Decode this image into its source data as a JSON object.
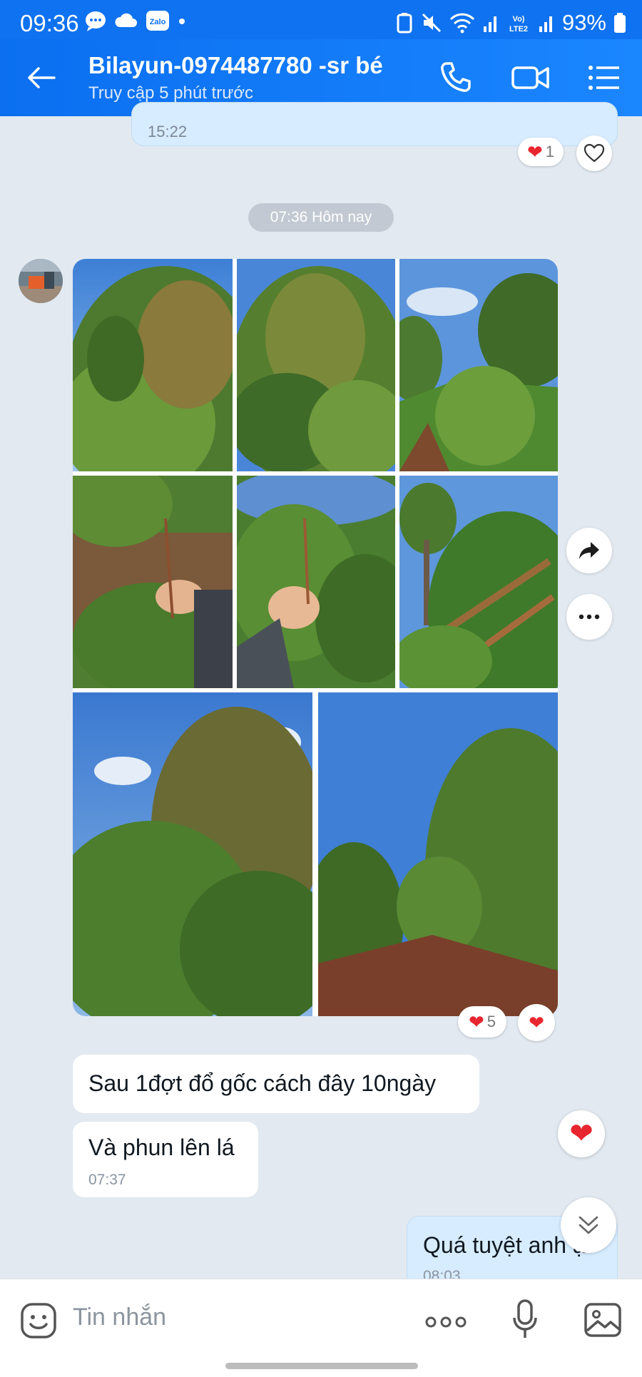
{
  "status_bar": {
    "time": "09:36",
    "battery": "93%"
  },
  "header": {
    "title": "Bilayun-0974487780 -sr bé",
    "subtitle": "Truy cập 5 phút trước"
  },
  "previous_message": {
    "time": "15:22",
    "reaction_count": "1"
  },
  "date_divider": "07:36 Hôm nay",
  "gallery": {
    "reaction_count": "5"
  },
  "messages": [
    {
      "text": "Sau 1đợt đổ gốc cách đây 10ngày"
    },
    {
      "text": "Và phun lên lá",
      "time": "07:37"
    }
  ],
  "my_message": {
    "text": "Quá tuyệt anh ạ",
    "time": "08:03"
  },
  "composer": {
    "placeholder": "Tin nhắn"
  },
  "colors": {
    "header": "#1a86ff",
    "accent": "#0b6ff0",
    "heart": "#e8262f",
    "my_bubble": "#d7ecff"
  }
}
